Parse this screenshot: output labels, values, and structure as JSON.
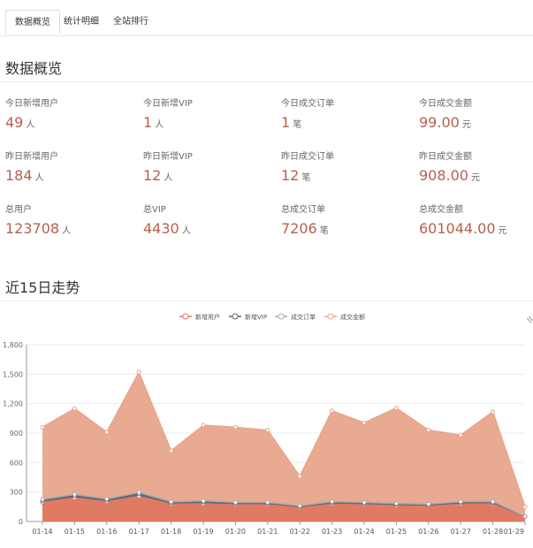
{
  "tabs": [
    {
      "label": "数据概览",
      "active": true
    },
    {
      "label": "统计明细",
      "active": false
    },
    {
      "label": "全站排行",
      "active": false
    }
  ],
  "overview": {
    "title": "数据概览",
    "stats": [
      {
        "label": "今日新增用户",
        "value": "49",
        "unit": "人"
      },
      {
        "label": "今日新增VIP",
        "value": "1",
        "unit": "人"
      },
      {
        "label": "今日成交订单",
        "value": "1",
        "unit": "笔"
      },
      {
        "label": "今日成交金额",
        "value": "99.00",
        "unit": "元"
      },
      {
        "label": "昨日新增用户",
        "value": "184",
        "unit": "人"
      },
      {
        "label": "昨日新增VIP",
        "value": "12",
        "unit": "人"
      },
      {
        "label": "昨日成交订单",
        "value": "12",
        "unit": "笔"
      },
      {
        "label": "昨日成交金额",
        "value": "908.00",
        "unit": "元"
      },
      {
        "label": "总用户",
        "value": "123708",
        "unit": "人"
      },
      {
        "label": "总VIP",
        "value": "4430",
        "unit": "人"
      },
      {
        "label": "总成交订单",
        "value": "7206",
        "unit": "笔"
      },
      {
        "label": "总成交金额",
        "value": "601044.00",
        "unit": "元"
      }
    ]
  },
  "trend": {
    "title": "近15日走势"
  },
  "colors": {
    "accent_value": "#b5614d",
    "new_users": "#e07a62",
    "new_vip": "#606a78",
    "orders": "#aaaaaa",
    "amount": "#e8a58c"
  },
  "chart_data": {
    "type": "area",
    "stacked": true,
    "categories": [
      "01-14",
      "01-15",
      "01-16",
      "01-17",
      "01-18",
      "01-19",
      "01-20",
      "01-21",
      "01-22",
      "01-23",
      "01-24",
      "01-25",
      "01-26",
      "01-27",
      "01-28",
      "01-29"
    ],
    "ylim": [
      0,
      1800
    ],
    "yticks": [
      "0",
      "300",
      "600",
      "900",
      "1,200",
      "1,500",
      "1,800"
    ],
    "grid": true,
    "legend_position": "top-center",
    "series": [
      {
        "name": "新增用户",
        "values": [
          195,
          240,
          200,
          255,
          175,
          180,
          170,
          170,
          140,
          175,
          170,
          160,
          155,
          175,
          180,
          49
        ]
      },
      {
        "name": "新增VIP",
        "values": [
          18,
          22,
          18,
          25,
          15,
          18,
          15,
          15,
          12,
          16,
          15,
          14,
          13,
          16,
          12,
          1
        ]
      },
      {
        "name": "成交订单",
        "values": [
          12,
          15,
          12,
          18,
          10,
          12,
          10,
          10,
          8,
          11,
          10,
          9,
          9,
          10,
          12,
          1
        ]
      },
      {
        "name": "成交金额",
        "values": [
          735,
          873,
          680,
          1222,
          520,
          770,
          765,
          735,
          300,
          925,
          810,
          972,
          753,
          679,
          913,
          99
        ]
      }
    ],
    "legend": [
      "新增用户",
      "新增VIP",
      "成交订单",
      "成交金额"
    ]
  }
}
